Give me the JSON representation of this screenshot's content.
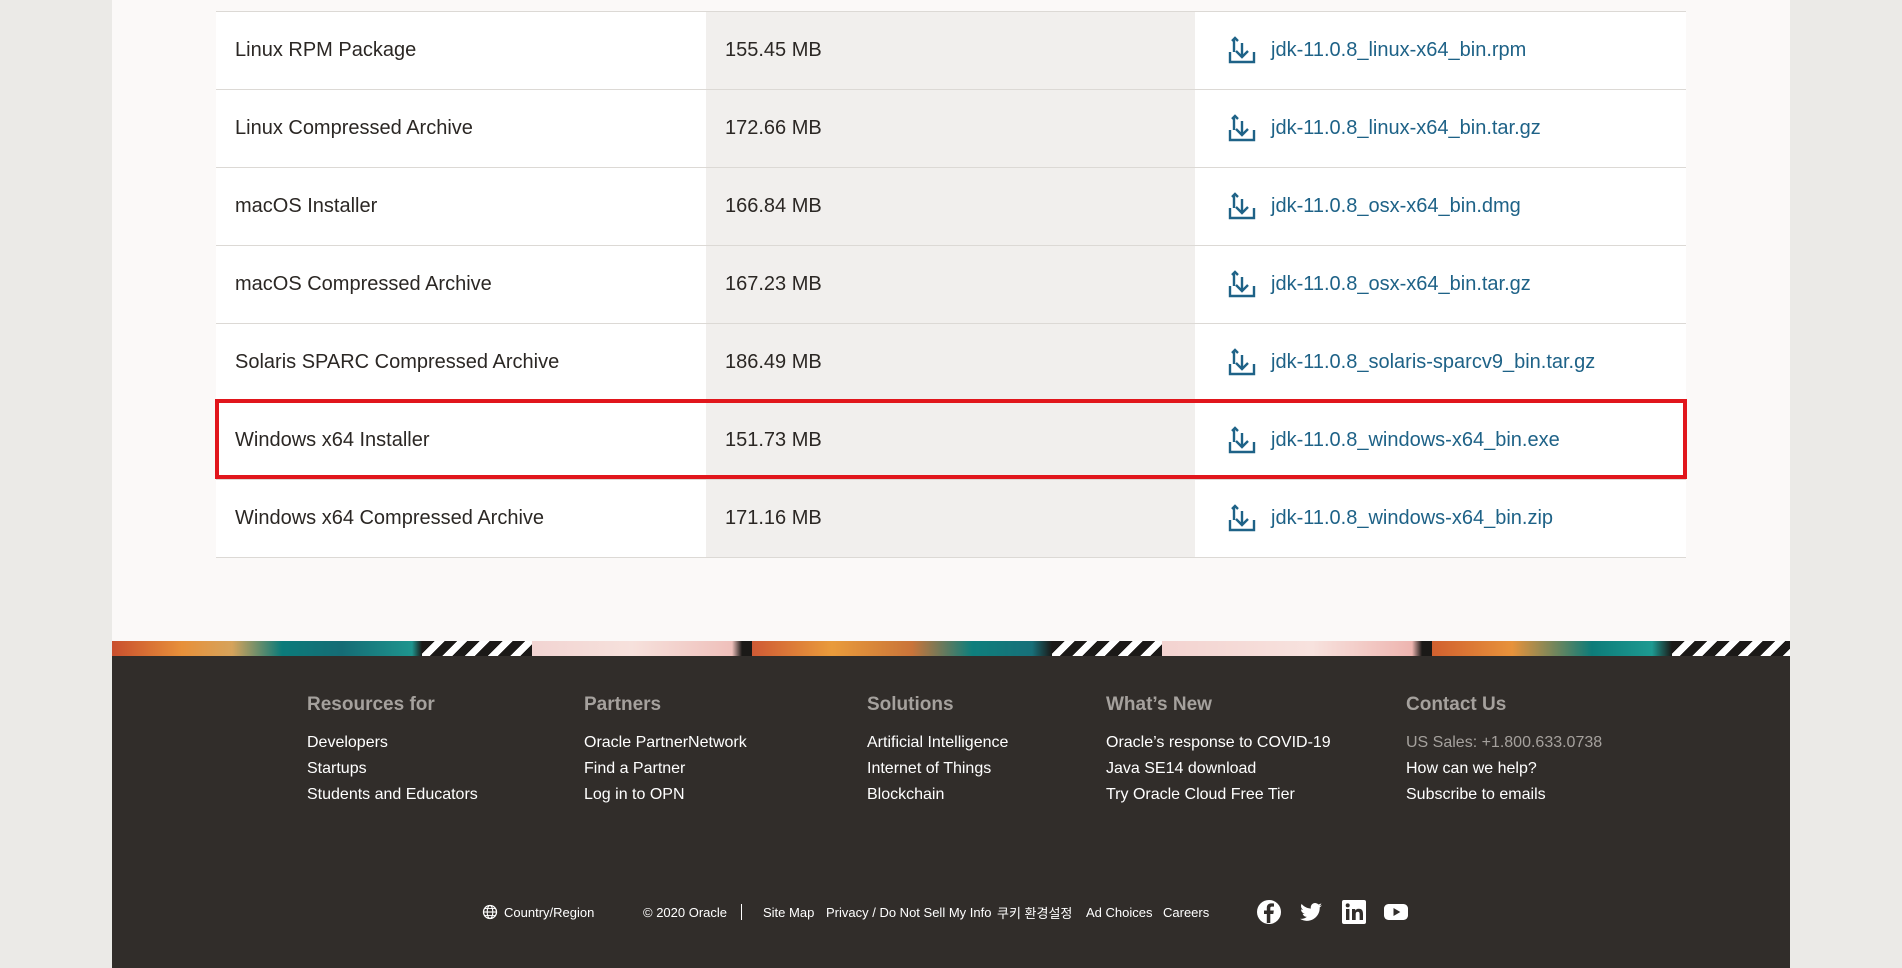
{
  "downloads": {
    "rows": [
      {
        "name": "Linux RPM Package",
        "size": "155.45 MB",
        "file": "jdk-11.0.8_linux-x64_bin.rpm"
      },
      {
        "name": "Linux Compressed Archive",
        "size": "172.66 MB",
        "file": "jdk-11.0.8_linux-x64_bin.tar.gz"
      },
      {
        "name": "macOS Installer",
        "size": "166.84 MB",
        "file": "jdk-11.0.8_osx-x64_bin.dmg"
      },
      {
        "name": "macOS Compressed Archive",
        "size": "167.23 MB",
        "file": "jdk-11.0.8_osx-x64_bin.tar.gz"
      },
      {
        "name": "Solaris SPARC Compressed Archive",
        "size": "186.49 MB",
        "file": "jdk-11.0.8_solaris-sparcv9_bin.tar.gz"
      },
      {
        "name": "Windows x64 Installer",
        "size": "151.73 MB",
        "file": "jdk-11.0.8_windows-x64_bin.exe"
      },
      {
        "name": "Windows x64 Compressed Archive",
        "size": "171.16 MB",
        "file": "jdk-11.0.8_windows-x64_bin.zip"
      }
    ],
    "download_icon": "download-icon"
  },
  "footer": {
    "columns": [
      {
        "title": "Resources for",
        "links": [
          "Developers",
          "Startups",
          "Students and Educators"
        ]
      },
      {
        "title": "Partners",
        "links": [
          "Oracle PartnerNetwork",
          "Find a Partner",
          "Log in to OPN"
        ]
      },
      {
        "title": "Solutions",
        "links": [
          "Artificial Intelligence",
          "Internet of Things",
          "Blockchain"
        ]
      },
      {
        "title": "What’s New",
        "links": [
          "Oracle’s response to COVID-19",
          "Java SE14 download",
          "Try Oracle Cloud Free Tier"
        ]
      },
      {
        "title": "Contact Us",
        "sales": "US Sales: +1.800.633.0738",
        "links": [
          "How can we help?",
          "Subscribe to emails"
        ]
      }
    ],
    "bottom": {
      "country": "Country/Region",
      "copyright": "© 2020 Oracle",
      "site_map": "Site Map",
      "privacy": "Privacy / Do Not Sell My Info",
      "cookie": "쿠키 환경설정",
      "ad_choices": "Ad Choices",
      "careers": "Careers"
    },
    "social_icons": [
      "facebook-icon",
      "twitter-icon",
      "linkedin-icon",
      "youtube-icon"
    ]
  },
  "colors": {
    "link": "#1e6287",
    "highlight": "#e1161c",
    "footer_bg": "#312d2a"
  }
}
